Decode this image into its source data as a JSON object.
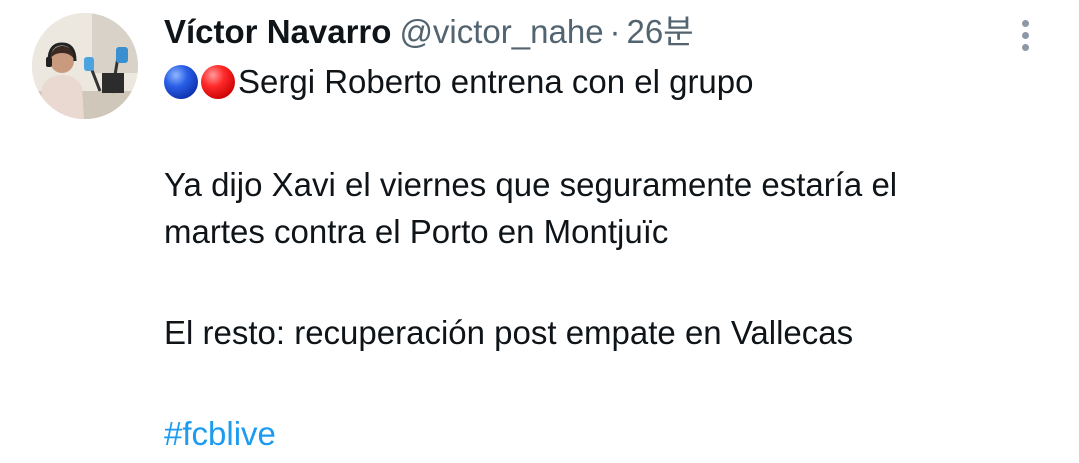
{
  "tweet": {
    "author": {
      "name": "Víctor Navarro",
      "handle": "@victor_nahe",
      "separator": "·",
      "time": "26분",
      "avatar": "avatar-photo"
    },
    "more_icon": "more-vertical-icon",
    "lines": [
      "Sergi Roberto entrena con el grupo",
      "Ya dijo Xavi el viernes que seguramente estaría el",
      "martes contra el Porto en Montjuïc",
      "El resto: recuperación post empate en Vallecas"
    ],
    "emojis": [
      "blue-circle-emoji",
      "red-circle-emoji"
    ],
    "hashtag": "#fcblive",
    "colors": {
      "text": "#0f1419",
      "secondary": "#536471",
      "link": "#1d9bf0",
      "background": "#ffffff"
    }
  }
}
